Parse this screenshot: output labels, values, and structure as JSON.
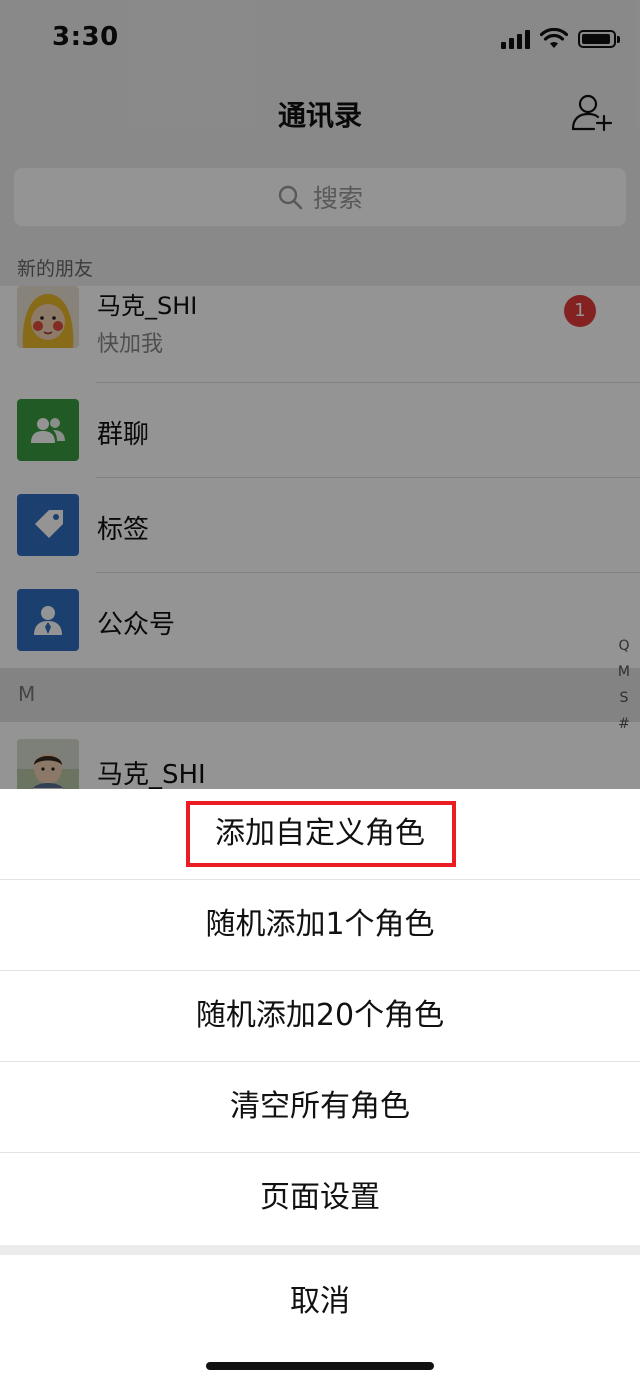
{
  "status_bar": {
    "time": "3:30"
  },
  "nav": {
    "title": "通讯录"
  },
  "search": {
    "placeholder": "搜索"
  },
  "new_friends": {
    "section_label": "新的朋友",
    "name": "马克_SHI",
    "message": "快加我",
    "badge_count": "1"
  },
  "menu_rows": [
    {
      "label": "群聊",
      "icon": "group-chat-icon",
      "color": "#3a9b3e"
    },
    {
      "label": "标签",
      "icon": "tag-icon",
      "color": "#2f6fbf"
    },
    {
      "label": "公众号",
      "icon": "official-account-icon",
      "color": "#2f6fbf"
    }
  ],
  "contacts_section": {
    "header": "M",
    "contact_name": "马克_SHI"
  },
  "index_letters": [
    "Q",
    "M",
    "S",
    "#"
  ],
  "action_sheet": {
    "items": [
      {
        "label": "添加自定义角色",
        "highlighted": true
      },
      {
        "label": "随机添加1个角色"
      },
      {
        "label": "随机添加20个角色"
      },
      {
        "label": "清空所有角色"
      },
      {
        "label": "页面设置"
      }
    ],
    "cancel": "取消",
    "highlight_color": "#ec1c24"
  }
}
